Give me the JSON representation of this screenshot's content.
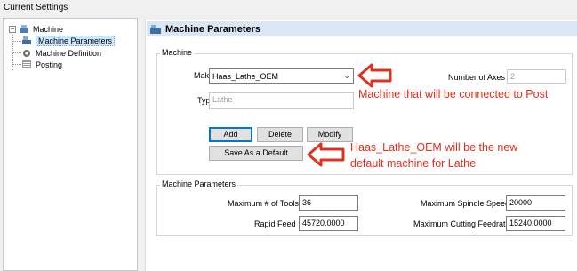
{
  "window": {
    "title": "Current Settings"
  },
  "tree": {
    "root": {
      "label": "Machine",
      "expander": "−",
      "icon": "machine-icon"
    },
    "items": [
      {
        "label": "Machine Parameters",
        "icon": "machine-parameters-icon",
        "selected": true
      },
      {
        "label": "Machine Definition",
        "icon": "machine-definition-icon",
        "selected": false
      },
      {
        "label": "Posting",
        "icon": "posting-icon",
        "selected": false
      }
    ]
  },
  "panel": {
    "title": "Machine Parameters",
    "icon": "machine-parameters-icon"
  },
  "machine_group": {
    "title": "Machine",
    "make_label": "Make",
    "make_value": "Haas_Lathe_OEM",
    "axes_label": "Number of Axes",
    "axes_value": "2",
    "type_label": "Type",
    "type_value": "Lathe",
    "add_label": "Add",
    "delete_label": "Delete",
    "modify_label": "Modify",
    "default_label": "Save As a Default"
  },
  "params_group": {
    "title": "Machine Parameters",
    "tools_label": "Maximum # of Tools",
    "tools_value": "36",
    "spindle_label": "Maximum Spindle Speed",
    "spindle_value": "20000",
    "rapid_label": "Rapid Feed",
    "rapid_value": "45720.0000",
    "cutting_label": "Maximum Cutting Feedrate",
    "cutting_value": "15240.0000"
  },
  "annotations": {
    "note1": "Machine that will be connected to Post",
    "note2_line1": "Haas_Lathe_OEM will be the new",
    "note2_line2": "default machine for Lathe",
    "color": "#e03020"
  }
}
